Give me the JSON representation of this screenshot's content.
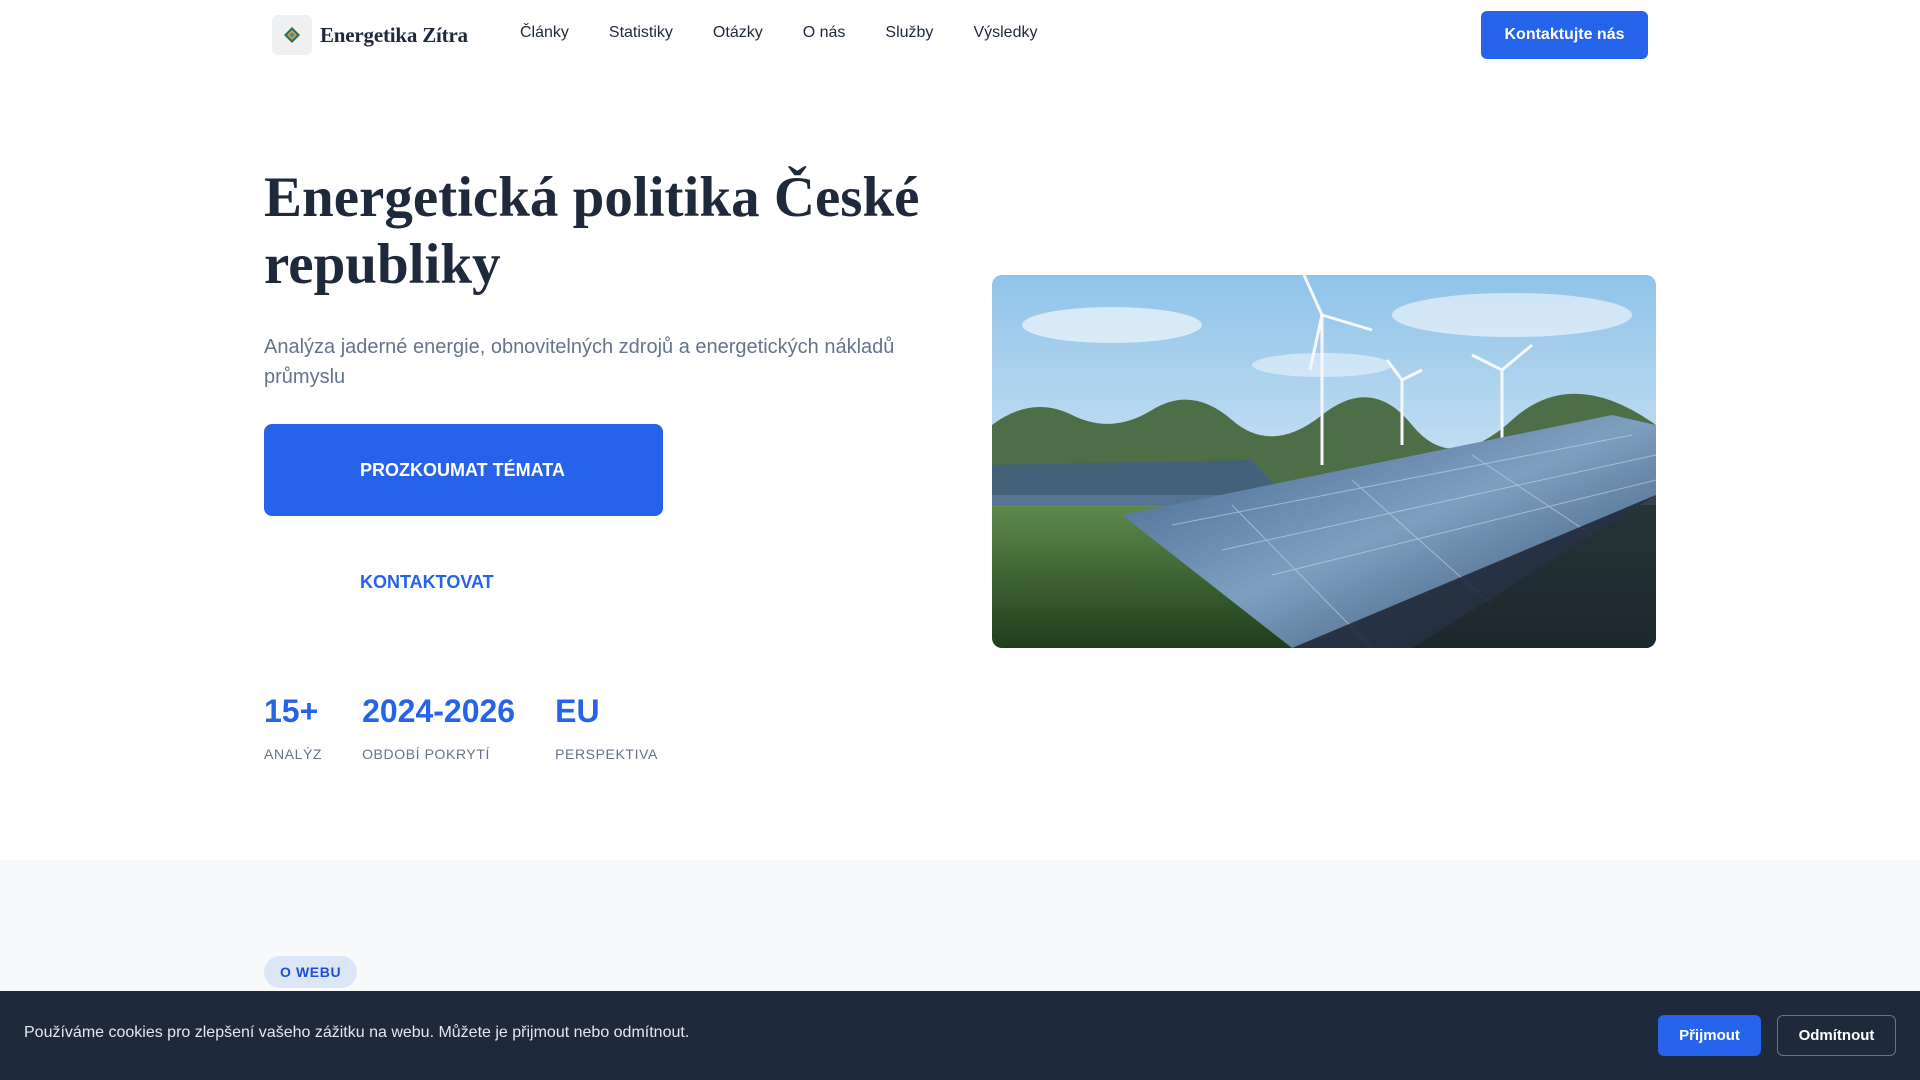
{
  "header": {
    "logo_text": "Energetika Zítra",
    "logo_icon": "leaf-diamond-icon",
    "nav": [
      "Články",
      "Statistiky",
      "Otázky",
      "O nás",
      "Služby",
      "Výsledky"
    ],
    "cta_label": "Kontaktujte nás"
  },
  "hero": {
    "title": "Energetická politika České republiky",
    "subtitle": "Analýza jaderné energie, obnovitelných zdrojů a energetických nákladů průmyslu",
    "primary_button": "PROZKOUMAT TÉMATA",
    "secondary_link": "KONTAKTOVAT",
    "image": "solar-panels-wind-turbines-photo"
  },
  "stats": [
    {
      "value": "15+",
      "label": "ANALÝZ"
    },
    {
      "value": "2024-2026",
      "label": "OBDOBÍ POKRYTÍ"
    },
    {
      "value": "EU",
      "label": "PERSPEKTIVA"
    }
  ],
  "about": {
    "badge": "O WEBU"
  },
  "cookie": {
    "text": "Používáme cookies pro zlepšení vašeho zážitku na webu. Můžete je přijmout nebo odmítnout.",
    "accept": "Přijmout",
    "reject": "Odmítnout"
  },
  "colors": {
    "accent": "#2563eb",
    "text": "#1e293b",
    "muted": "#64748b",
    "cookie_bg": "#1e293b"
  }
}
